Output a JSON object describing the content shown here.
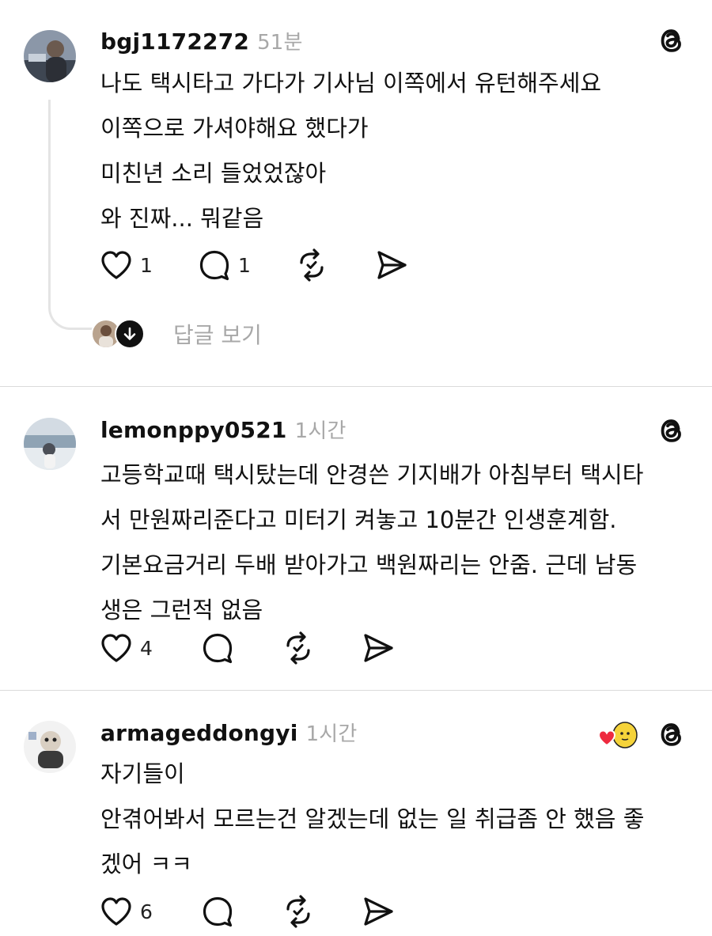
{
  "posts": [
    {
      "username": "bgj1172272",
      "time": "51분",
      "lines": [
        "나도 택시타고 가다가 기사님 이쪽에서 유턴해주세요",
        "이쪽으로 가셔야해요 했다가",
        "미친년 소리 들었었잖아",
        "와 진짜... 뭐같음"
      ],
      "likes": "1",
      "comments": "1",
      "view_replies": "답글 보기"
    },
    {
      "username": "lemonppy0521",
      "time": "1시간",
      "lines": [
        "고등학교때 택시탔는데 안경쓴 기지배가 아침부터 택시타",
        "서 만원짜리준다고 미터기 켜놓고 10분간 인생훈계함.",
        "기본요금거리 두배 받아가고 백원짜리는 안줌. 근데 남동",
        "생은 그런적 없음"
      ],
      "likes": "4"
    },
    {
      "username": "armageddongyi",
      "time": "1시간",
      "lines": [
        "자기들이",
        "안겪어봐서 모르는건 알겠는데 없는 일 취급좀 안 했음 좋",
        "겠어 ㅋㅋ"
      ],
      "likes": "6"
    }
  ],
  "icons": {
    "brand": "threads-icon",
    "like": "heart-icon",
    "comment": "comment-icon",
    "repost": "repost-icon",
    "share": "share-icon"
  }
}
